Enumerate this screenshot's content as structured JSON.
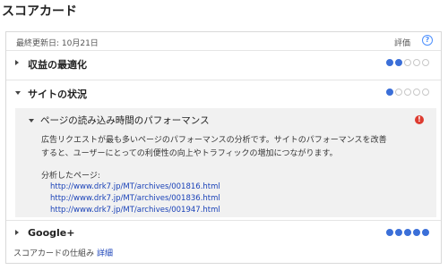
{
  "page": {
    "title": "スコアカード"
  },
  "card": {
    "last_updated": "最終更新日: 10月21日",
    "rating_label": "評価",
    "help_glyph": "?"
  },
  "sections": [
    {
      "label": "収益の最適化",
      "expanded": false,
      "score": 2,
      "max": 5
    },
    {
      "label": "サイトの状況",
      "expanded": true,
      "score": 1,
      "max": 5
    },
    {
      "label": "Google+",
      "expanded": false,
      "score": 5,
      "max": 5
    }
  ],
  "subsection": {
    "title": "ページの読み込み時間のパフォーマンス",
    "alert_glyph": "!",
    "description_line1": "広告リクエストが最も多いページのパフォーマンスの分析です。サイトのパフォーマンスを改善",
    "description_line2": "すると、ユーザーにとっての利便性の向上やトラフィックの増加につながります。",
    "pages_label": "分析したページ:",
    "urls": [
      "http://www.drk7.jp/MT/archives/001816.html",
      "http://www.drk7.jp/MT/archives/001836.html",
      "http://www.drk7.jp/MT/archives/001947.html"
    ]
  },
  "footer": {
    "text": "スコアカードの仕組み",
    "link": "詳細"
  },
  "colors": {
    "accent": "#3b6fd8",
    "link": "#1a42b8",
    "alert": "#dd3b30"
  },
  "icons": [
    "help-icon",
    "expand-arrow-icon",
    "collapse-arrow-icon",
    "alert-icon"
  ]
}
